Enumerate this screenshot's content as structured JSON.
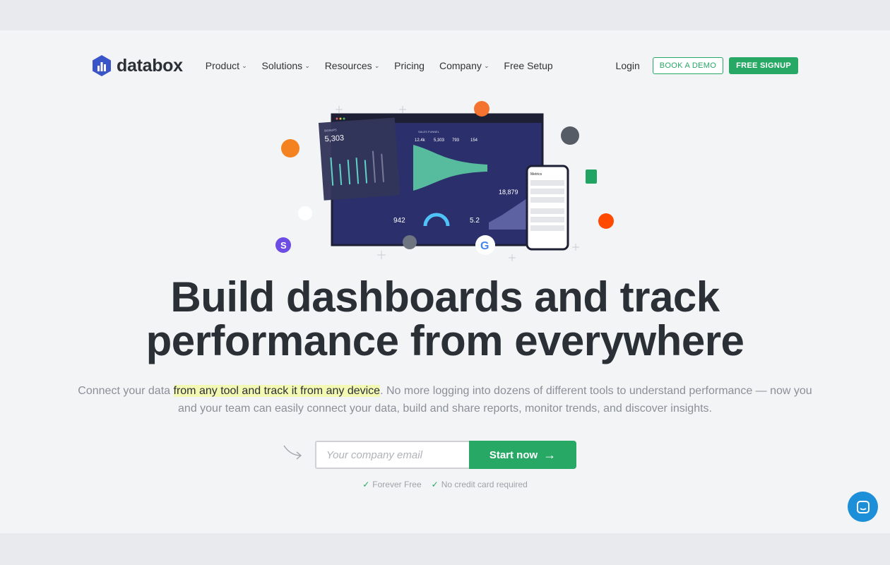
{
  "brand": {
    "name": "databox",
    "color": "#27a865"
  },
  "nav": {
    "items": [
      {
        "label": "Product",
        "dropdown": true
      },
      {
        "label": "Solutions",
        "dropdown": true
      },
      {
        "label": "Resources",
        "dropdown": true
      },
      {
        "label": "Pricing"
      },
      {
        "label": "Company",
        "dropdown": true
      },
      {
        "label": "Free Setup"
      }
    ],
    "login": "Login",
    "demo": "BOOK A DEMO",
    "signup": "FREE SIGNUP"
  },
  "hero": {
    "illustration": {
      "signups": "5,303",
      "funnel": [
        "12.4k",
        "5,303",
        "793",
        "154"
      ],
      "sessions": "18,879",
      "subs": "942",
      "position": "5.2",
      "phone_title": "Metrics",
      "panel_title": "SIGNUPS",
      "funnel_title": "SALES FUNNEL"
    },
    "title_line1": "Build dashboards and track",
    "title_line2": "performance from everywhere",
    "sub_pre": "Connect your data ",
    "sub_hl": "from any tool and track it from any device",
    "sub_post": ". No more logging into dozens of different tools to understand performance — now you and your team can easily connect your data, build and share reports, monitor trends, and discover insights.",
    "email_placeholder": "Your company email",
    "start": "Start now",
    "check1": "Forever Free",
    "check2": "No credit card required"
  }
}
